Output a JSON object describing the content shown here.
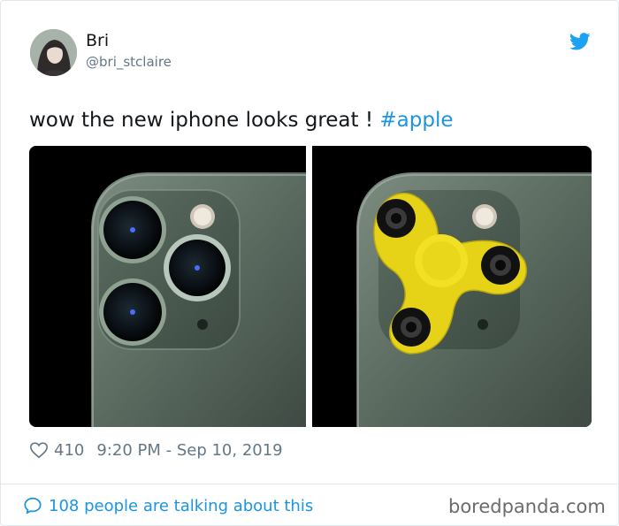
{
  "author": {
    "display_name": "Bri",
    "handle": "@bri_stclaire",
    "avatar_icon": "avatar-photo"
  },
  "brand": {
    "icon": "twitter-bird-icon",
    "color": "#1da1f2"
  },
  "tweet": {
    "text": "wow the new iphone looks great ! ",
    "hashtag": "#apple",
    "hashtag_color": "#1b95e0"
  },
  "media": [
    {
      "name": "iphone-triple-camera-photo"
    },
    {
      "name": "iphone-fidget-spinner-photo"
    }
  ],
  "meta": {
    "like_icon": "heart-icon",
    "likes": "410",
    "timestamp": "9:20 PM - Sep 10, 2019"
  },
  "footer": {
    "icon": "speech-bubble-icon",
    "conversation_text": "108 people are talking about this"
  },
  "watermark": "boredpanda.com"
}
